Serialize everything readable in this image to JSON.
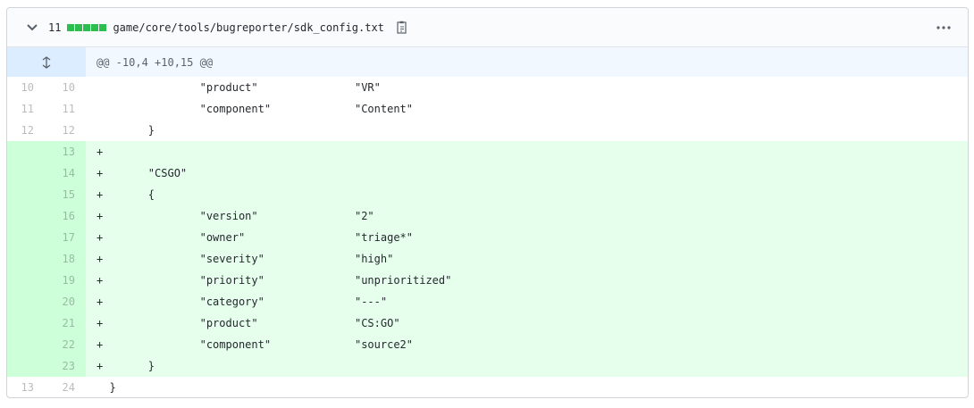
{
  "file": {
    "line_count": "11",
    "diffstat_blocks": 5,
    "path": "game/core/tools/bugreporter/sdk_config.txt",
    "hunk_header": "@@ -10,4 +10,15 @@",
    "accent": "#2cbe4e"
  },
  "lines": [
    {
      "type": "context",
      "old": "10",
      "new": "10",
      "code": "\t\t\"product\"\t\t\"VR\""
    },
    {
      "type": "context",
      "old": "11",
      "new": "11",
      "code": "\t\t\"component\"\t\t\"Content\""
    },
    {
      "type": "context",
      "old": "12",
      "new": "12",
      "code": "\t}"
    },
    {
      "type": "add",
      "old": "",
      "new": "13",
      "code": "+"
    },
    {
      "type": "add",
      "old": "",
      "new": "14",
      "code": "+\t\"CSGO\""
    },
    {
      "type": "add",
      "old": "",
      "new": "15",
      "code": "+\t{"
    },
    {
      "type": "add",
      "old": "",
      "new": "16",
      "code": "+\t\t\"version\"\t\t\"2\""
    },
    {
      "type": "add",
      "old": "",
      "new": "17",
      "code": "+\t\t\"owner\"\t\t\t\"triage*\""
    },
    {
      "type": "add",
      "old": "",
      "new": "18",
      "code": "+\t\t\"severity\"\t\t\"high\""
    },
    {
      "type": "add",
      "old": "",
      "new": "19",
      "code": "+\t\t\"priority\"\t\t\"unprioritized\""
    },
    {
      "type": "add",
      "old": "",
      "new": "20",
      "code": "+\t\t\"category\"\t\t\"---\""
    },
    {
      "type": "add",
      "old": "",
      "new": "21",
      "code": "+\t\t\"product\"\t\t\"CS:GO\""
    },
    {
      "type": "add",
      "old": "",
      "new": "22",
      "code": "+\t\t\"component\"\t\t\"source2\""
    },
    {
      "type": "add",
      "old": "",
      "new": "23",
      "code": "+\t}"
    },
    {
      "type": "context",
      "old": "13",
      "new": "24",
      "code": "  }"
    }
  ]
}
